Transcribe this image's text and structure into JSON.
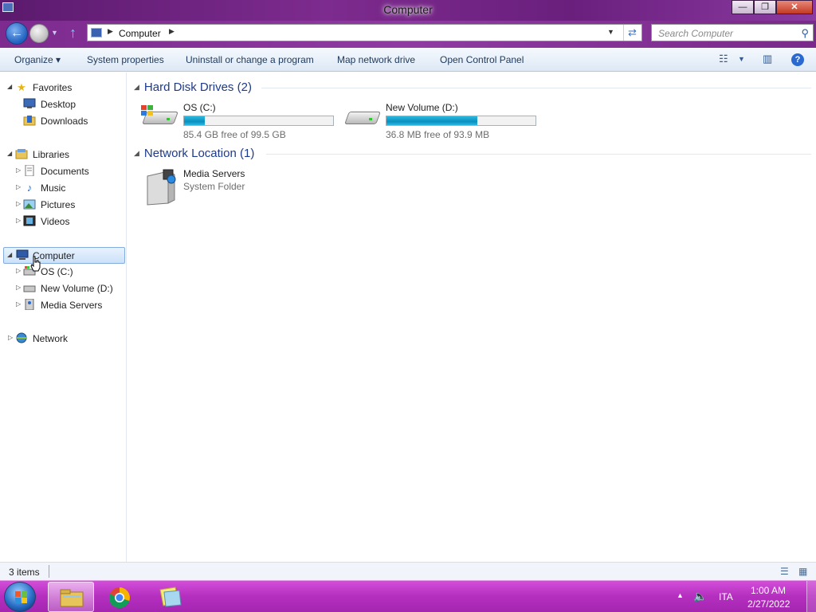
{
  "window": {
    "title": "Computer",
    "minimize_glyph": "—",
    "maximize_glyph": "❐",
    "close_glyph": "✕"
  },
  "nav": {
    "back_glyph": "←",
    "up_glyph": "↑",
    "address_segments": [
      "Computer"
    ],
    "search_placeholder": "Search Computer"
  },
  "commands": [
    {
      "label": "Organize ▾"
    },
    {
      "label": "System properties"
    },
    {
      "label": "Uninstall or change a program"
    },
    {
      "label": "Map network drive"
    },
    {
      "label": "Open Control Panel"
    }
  ],
  "sidebar": {
    "favorites": {
      "label": "Favorites",
      "items": [
        {
          "label": "Desktop"
        },
        {
          "label": "Downloads"
        }
      ]
    },
    "libraries": {
      "label": "Libraries",
      "items": [
        {
          "label": "Documents"
        },
        {
          "label": "Music"
        },
        {
          "label": "Pictures"
        },
        {
          "label": "Videos"
        }
      ]
    },
    "computer": {
      "label": "Computer",
      "items": [
        {
          "label": "OS (C:)"
        },
        {
          "label": "New Volume (D:)"
        },
        {
          "label": "Media Servers"
        }
      ]
    },
    "network": {
      "label": "Network"
    }
  },
  "groups": {
    "hdd": {
      "header": "Hard Disk Drives (2)",
      "drives": [
        {
          "name": "OS (C:)",
          "free_text": "85.4 GB free of 99.5 GB",
          "used_fraction": 0.14
        },
        {
          "name": "New Volume (D:)",
          "free_text": "36.8 MB free of 93.9 MB",
          "used_fraction": 0.61
        }
      ]
    },
    "network": {
      "header": "Network Location (1)",
      "items": [
        {
          "name": "Media Servers",
          "type": "System Folder"
        }
      ]
    }
  },
  "status": {
    "items_text": "3 items"
  },
  "taskbar": {
    "tray_language": "ITA",
    "clock_time": "1:00 AM",
    "clock_date": "2/27/2022"
  },
  "colors": {
    "accent": "#1e3a8a",
    "capacity_fill": "#0a8fbf",
    "taskbar": "#b52fbf",
    "selection_border": "#84acdd"
  }
}
